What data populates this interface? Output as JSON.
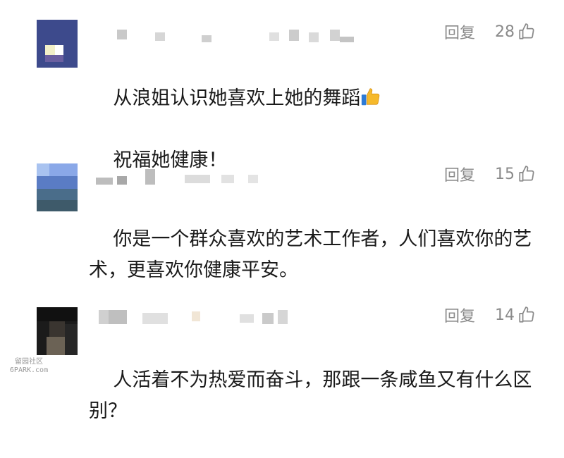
{
  "comments": [
    {
      "reply_label": "回复",
      "likes": "28",
      "text": "从浪姐认识她喜欢上她的舞蹈",
      "text2": "祝福她健康！",
      "emoji": "thumbs-up-emoji"
    },
    {
      "reply_label": "回复",
      "likes": "15",
      "text": "你是一个群众喜欢的艺术工作者，人们喜欢你的艺术，更喜欢你健康平安。"
    },
    {
      "reply_label": "回复",
      "likes": "14",
      "text": "人活着不为热爱而奋斗，那跟一条咸鱼又有什么区别？"
    }
  ],
  "watermark": {
    "line1": "留园社区",
    "line2": "6PARK.com"
  },
  "icons": {
    "like": "thumbs-up-outline-icon"
  },
  "colors": {
    "meta_text": "#8a8a8a",
    "body_text": "#1a1a1a"
  }
}
